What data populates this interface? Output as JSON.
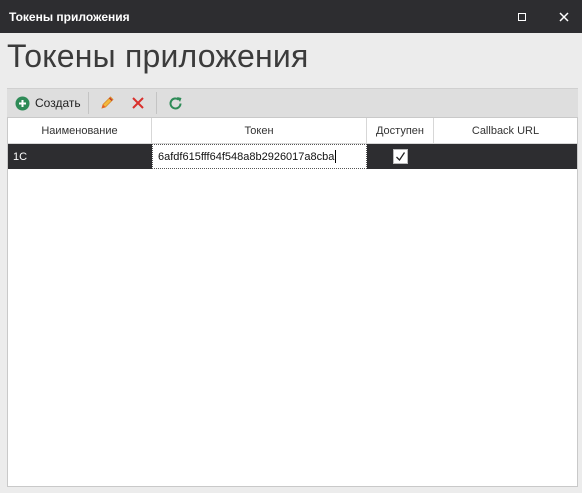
{
  "window": {
    "title": "Токены приложения"
  },
  "page": {
    "heading": "Токены приложения"
  },
  "toolbar": {
    "create_label": "Создать"
  },
  "grid": {
    "columns": [
      "Наименование",
      "Токен",
      "Доступен",
      "Callback URL"
    ],
    "rows": [
      {
        "name": "1C",
        "token": "6afdf615fff64f548a8b2926017a8cba",
        "available": true,
        "callback_url": ""
      }
    ]
  },
  "colors": {
    "titlebar": "#2d2d30",
    "create_icon": "#2e8b57",
    "delete_icon": "#d9302c",
    "refresh_icon": "#2e8b57",
    "edit_icon": "#e8a317"
  }
}
